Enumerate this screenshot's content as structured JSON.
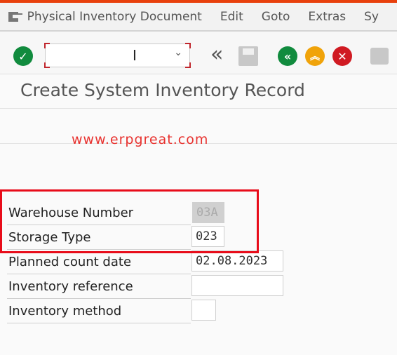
{
  "menu": {
    "items": [
      "Physical Inventory Document",
      "Edit",
      "Goto",
      "Extras",
      "Sy"
    ]
  },
  "toolbar": {
    "command_value": "",
    "icons": [
      "check-icon",
      "save-icon",
      "back-icon",
      "exit-icon",
      "cancel-icon",
      "print-icon"
    ],
    "colors": {
      "check": "#118b3e",
      "back": "#118b3e",
      "exit": "#f0a30a",
      "cancel": "#d01a22"
    }
  },
  "page": {
    "title": "Create System Inventory Record",
    "watermark": "www.erpgreat.com"
  },
  "form": {
    "warehouse_number": {
      "label": "Warehouse Number",
      "value": "03A"
    },
    "storage_type": {
      "label": "Storage Type",
      "value": "023"
    },
    "planned_count_date": {
      "label": "Planned count date",
      "value": "02.08.2023"
    },
    "inventory_reference": {
      "label": "Inventory reference",
      "value": ""
    },
    "inventory_method": {
      "label": "Inventory method",
      "value": ""
    }
  }
}
